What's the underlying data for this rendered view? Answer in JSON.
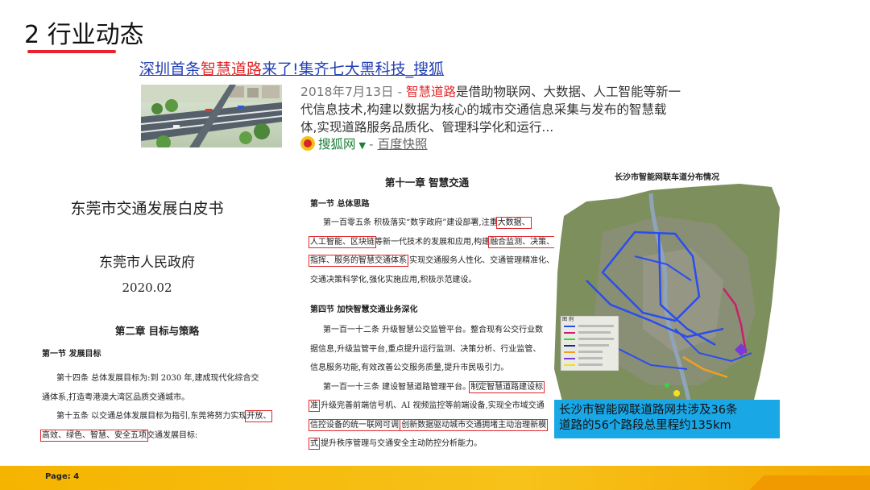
{
  "slide": {
    "title": "2 行业动态",
    "page_label": "Page: 4"
  },
  "search_result": {
    "title_a": "深圳首条",
    "title_hl": "智慧道路",
    "title_b": "来了!集齐七大黑科技_搜狐",
    "date": "2018年7月13日 - ",
    "snippet_hl": "智慧道路",
    "snippet_l1": "是借助物联网、大数据、人工智能等新一",
    "snippet_l2": "代信息技术,构建以数据为核心的城市交通信息采集与发布的智慧载",
    "snippet_l3": "体,实现道路服务品质化、管理科学化和运行...",
    "source_name": "搜狐网",
    "source_dash": "-",
    "kuaizhao": "百度快照"
  },
  "white_paper": {
    "title": "东莞市交通发展白皮书",
    "publisher": "东莞市人民政府",
    "date": "2020.02",
    "chapter": "第二章  目标与策略",
    "section": "第一节  发展目标",
    "art14_l1": "第十四条    总体发展目标为:到 2030 年,建成现代化综合交",
    "art14_l2": "通体系,打造粤港澳大湾区品质交通城市。",
    "art15_l1a": "第十五条    以交通总体发展目标为指引,东莞将努力实现",
    "art15_l1box": "开放、",
    "art15_l2box": "高效、绿色、智慧、安全五项",
    "art15_l2b": "交通发展目标:"
  },
  "smart_transport": {
    "chapter": "第十一章  智慧交通",
    "section1": "第一节  总体思路",
    "a105_l1a": "第一百零五条  积极落实“数字政府”建设部署,注重",
    "a105_l1box": "大数据、",
    "a105_l2box": "人工智能、区块链",
    "a105_l2b": "等新一代技术的发展和应用,构建",
    "a105_l2box2": "融合监测、决策、",
    "a105_l3box": "指挥、服务的智慧交通体系",
    "a105_l3b": ",实现交通服务人性化、交通管理精准化、",
    "a105_l4": "交通决策科学化,强化实施应用,积极示范建设。",
    "section4": "第四节  加快智慧交通业务深化",
    "a112_l1": "第一百一十二条  升级智慧公交监管平台。整合现有公交行业数",
    "a112_l2": "据信息,升级监管平台,重点提升运行监测、决策分析、行业监管、",
    "a112_l3": "信息服务功能,有效改善公交服务质量,提升市民吸引力。",
    "a113_l1a": "第一百一十三条  建设智慧道路管理平台。",
    "a113_l1box": "制定智慧道路建设标",
    "a113_l2box": "准",
    "a113_l2b": ",升级完善前端信号机、AI 视频监控等前端设备,实现全市域交通",
    "a113_l3box": "信控设备的统一联网可调",
    "a113_l3b": ",",
    "a113_l3box2": "创新数据驱动城市交通拥堵主动治理新模",
    "a113_l4box": "式",
    "a113_l4b": ",提升秩序管理与交通安全主动防控分析能力。"
  },
  "map": {
    "title": "长沙市智能网联车道分布情况",
    "legend_title": "图 例",
    "caption_l1": "长沙市智能网联道路网共涉及36条",
    "caption_l2": "道路的56个路段总里程约135km"
  }
}
